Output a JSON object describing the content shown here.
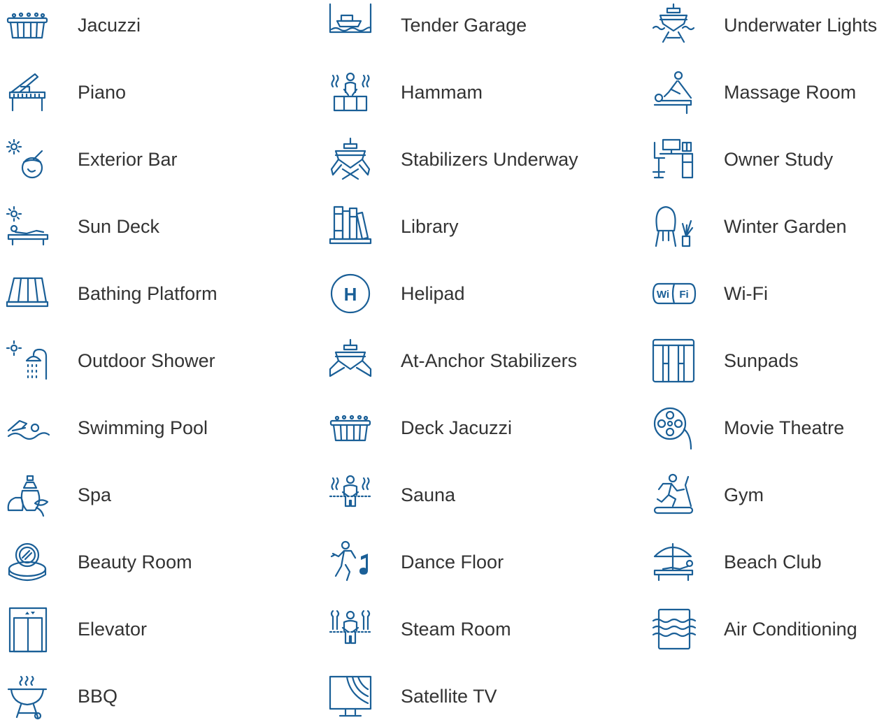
{
  "accent_color": "#1a5f97",
  "columns": [
    {
      "items": [
        {
          "label": "Jacuzzi",
          "icon": "jacuzzi-icon"
        },
        {
          "label": "Piano",
          "icon": "piano-icon"
        },
        {
          "label": "Exterior Bar",
          "icon": "exterior-bar-icon"
        },
        {
          "label": "Sun Deck",
          "icon": "sun-deck-icon"
        },
        {
          "label": "Bathing Platform",
          "icon": "bathing-platform-icon"
        },
        {
          "label": "Outdoor Shower",
          "icon": "outdoor-shower-icon"
        },
        {
          "label": "Swimming Pool",
          "icon": "swimming-pool-icon"
        },
        {
          "label": "Spa",
          "icon": "spa-icon"
        },
        {
          "label": "Beauty Room",
          "icon": "beauty-room-icon"
        },
        {
          "label": "Elevator",
          "icon": "elevator-icon"
        },
        {
          "label": "BBQ",
          "icon": "bbq-icon"
        }
      ]
    },
    {
      "items": [
        {
          "label": "Tender Garage",
          "icon": "tender-garage-icon"
        },
        {
          "label": "Hammam",
          "icon": "hammam-icon"
        },
        {
          "label": "Stabilizers Underway",
          "icon": "stabilizers-underway-icon"
        },
        {
          "label": "Library",
          "icon": "library-icon"
        },
        {
          "label": "Helipad",
          "icon": "helipad-icon"
        },
        {
          "label": "At-Anchor Stabilizers",
          "icon": "at-anchor-stabilizers-icon"
        },
        {
          "label": "Deck Jacuzzi",
          "icon": "deck-jacuzzi-icon"
        },
        {
          "label": "Sauna",
          "icon": "sauna-icon"
        },
        {
          "label": "Dance Floor",
          "icon": "dance-floor-icon"
        },
        {
          "label": "Steam Room",
          "icon": "steam-room-icon"
        },
        {
          "label": "Satellite TV",
          "icon": "satellite-tv-icon"
        }
      ]
    },
    {
      "items": [
        {
          "label": "Underwater Lights",
          "icon": "underwater-lights-icon"
        },
        {
          "label": "Massage Room",
          "icon": "massage-room-icon"
        },
        {
          "label": "Owner Study",
          "icon": "owner-study-icon"
        },
        {
          "label": "Winter Garden",
          "icon": "winter-garden-icon"
        },
        {
          "label": "Wi-Fi",
          "icon": "wifi-icon"
        },
        {
          "label": "Sunpads",
          "icon": "sunpads-icon"
        },
        {
          "label": "Movie Theatre",
          "icon": "movie-theatre-icon"
        },
        {
          "label": "Gym",
          "icon": "gym-icon"
        },
        {
          "label": "Beach Club",
          "icon": "beach-club-icon"
        },
        {
          "label": "Air Conditioning",
          "icon": "air-conditioning-icon"
        }
      ]
    }
  ],
  "icon_text": {
    "helipad": "H",
    "wifi_left": "Wi",
    "wifi_right": "Fi"
  }
}
